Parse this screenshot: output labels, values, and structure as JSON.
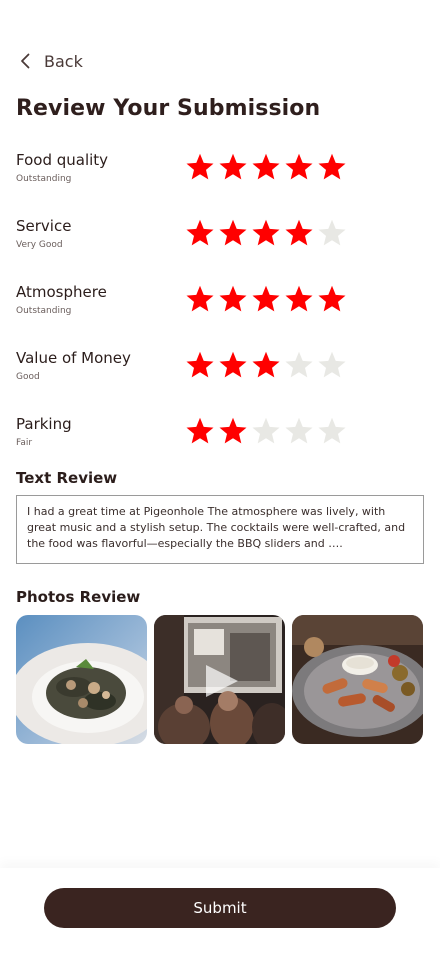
{
  "nav": {
    "back_label": "Back"
  },
  "page": {
    "title": "Review Your Submission"
  },
  "colors": {
    "star_filled": "#FF0000",
    "star_empty": "#E8E8E4",
    "submit_bg": "#3A2420"
  },
  "ratings": [
    {
      "label": "Food quality",
      "sub": "Outstanding",
      "value": 5,
      "max": 5
    },
    {
      "label": "Service",
      "sub": "Very Good",
      "value": 4,
      "max": 5
    },
    {
      "label": "Atmosphere",
      "sub": "Outstanding",
      "value": 5,
      "max": 5
    },
    {
      "label": "Value of Money",
      "sub": "Good",
      "value": 3,
      "max": 5
    },
    {
      "label": "Parking",
      "sub": "Fair",
      "value": 2,
      "max": 5
    }
  ],
  "text_review": {
    "title": "Text Review",
    "body": "I had a great time at Pigeonhole The atmosphere  was lively, with great music and a stylish setup. The cocktails were well-crafted, and the food was  flavorful—especially the BBQ sliders and …."
  },
  "photos": {
    "title": "Photos Review",
    "items": [
      {
        "kind": "photo",
        "icon": "food-plate-photo"
      },
      {
        "kind": "video",
        "icon": "play-icon"
      },
      {
        "kind": "photo",
        "icon": "food-platter-photo"
      }
    ]
  },
  "footer": {
    "submit_label": "Submit"
  }
}
